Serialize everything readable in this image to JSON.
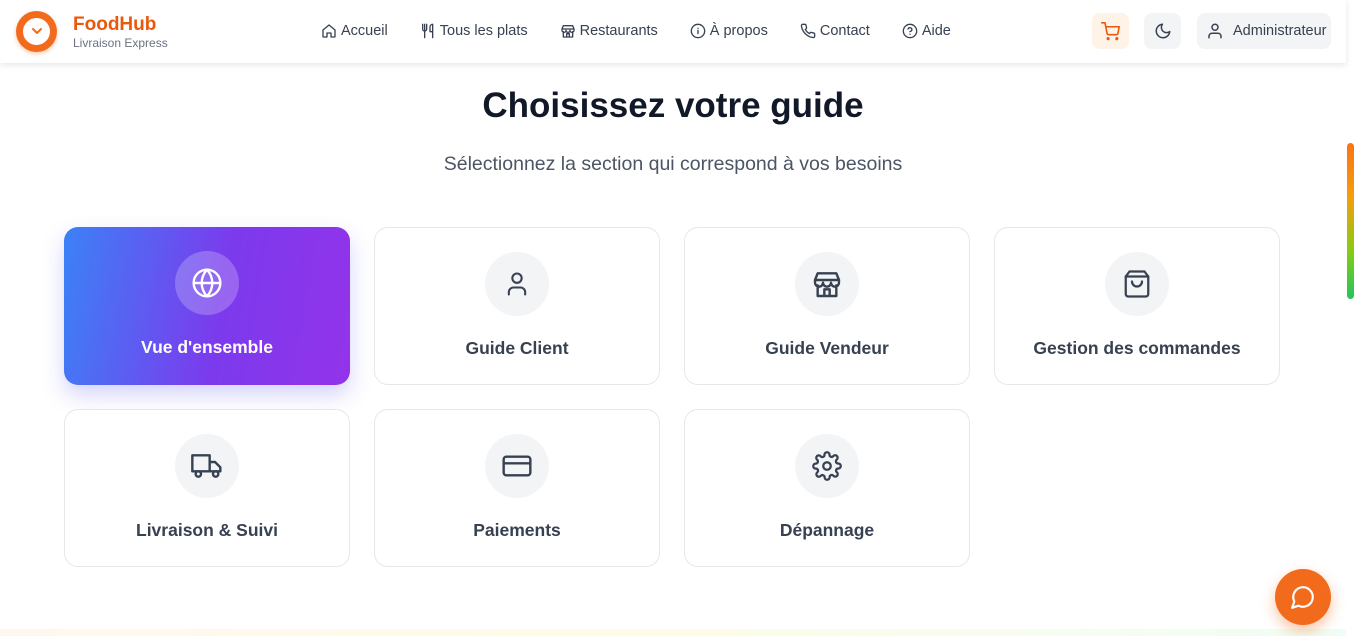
{
  "brand": {
    "name": "FoodHub",
    "tagline": "Livraison Express"
  },
  "nav": [
    {
      "label": "Accueil",
      "icon": "home-icon"
    },
    {
      "label": "Tous les plats",
      "icon": "utensils-icon"
    },
    {
      "label": "Restaurants",
      "icon": "store-icon"
    },
    {
      "label": "À propos",
      "icon": "info-icon"
    },
    {
      "label": "Contact",
      "icon": "phone-icon"
    },
    {
      "label": "Aide",
      "icon": "help-icon"
    }
  ],
  "header_actions": {
    "cart_icon": "cart-icon",
    "theme_icon": "moon-icon",
    "user_label": "Administrateur"
  },
  "main": {
    "title": "Choisissez votre guide",
    "subtitle": "Sélectionnez la section qui correspond à vos besoins"
  },
  "guides": [
    {
      "label": "Vue d'ensemble",
      "icon": "globe-icon",
      "active": true
    },
    {
      "label": "Guide Client",
      "icon": "user-icon",
      "active": false
    },
    {
      "label": "Guide Vendeur",
      "icon": "store-icon",
      "active": false
    },
    {
      "label": "Gestion des commandes",
      "icon": "shopping-bag-icon",
      "active": false
    },
    {
      "label": "Livraison & Suivi",
      "icon": "truck-icon",
      "active": false
    },
    {
      "label": "Paiements",
      "icon": "credit-card-icon",
      "active": false
    },
    {
      "label": "Dépannage",
      "icon": "gear-icon",
      "active": false
    }
  ],
  "colors": {
    "brand_orange": "#f26b1d",
    "gradient_start": "#3b82f6",
    "gradient_end": "#9333ea"
  },
  "chat": {
    "icon": "chat-bubble-icon"
  }
}
